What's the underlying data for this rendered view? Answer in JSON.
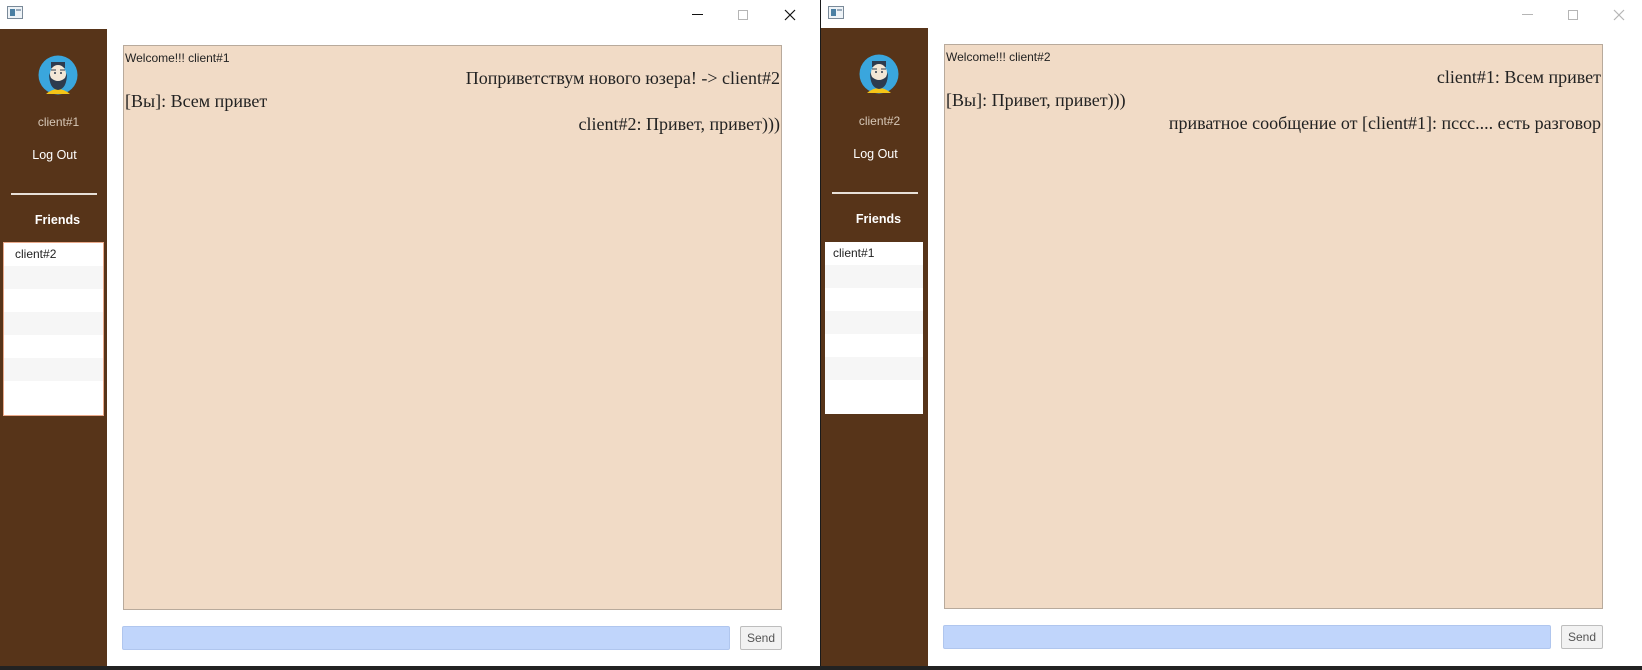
{
  "windows": [
    {
      "sidebar": {
        "username": "client#1",
        "logout_label": "Log Out",
        "friends_label": "Friends",
        "friends": [
          "client#2",
          "",
          "",
          "",
          "",
          "",
          ""
        ]
      },
      "chat": {
        "welcome": "Welcome!!! client#1",
        "messages": [
          {
            "text": "Поприветствум нового юзера! -> client#2",
            "align": "right"
          },
          {
            "text": "[Вы]: Всем привет",
            "align": "left"
          },
          {
            "text": "client#2: Привет, привет)))",
            "align": "right"
          }
        ]
      },
      "input": {
        "value": "",
        "placeholder": ""
      },
      "send_label": "Send"
    },
    {
      "sidebar": {
        "username": "client#2",
        "logout_label": "Log Out",
        "friends_label": "Friends",
        "friends": [
          "client#1",
          "",
          "",
          "",
          "",
          "",
          ""
        ]
      },
      "chat": {
        "welcome": "Welcome!!! client#2",
        "messages": [
          {
            "text": "client#1: Всем привет",
            "align": "right"
          },
          {
            "text": "[Вы]: Привет, привет)))",
            "align": "left"
          },
          {
            "text": "приватное сообщение от [client#1]: пссс.... есть разговор",
            "align": "right"
          }
        ]
      },
      "input": {
        "value": "",
        "placeholder": ""
      },
      "send_label": "Send"
    }
  ],
  "colors": {
    "sidebar_bg": "#573419",
    "chat_bg": "#f1dbc6",
    "input_bg": "#c0d5fb"
  },
  "icons": {
    "window_icon": "app-window-icon",
    "avatar": "bearded-man-avatar-icon",
    "minimize": "minimize-icon",
    "maximize": "maximize-icon",
    "close": "close-icon"
  }
}
